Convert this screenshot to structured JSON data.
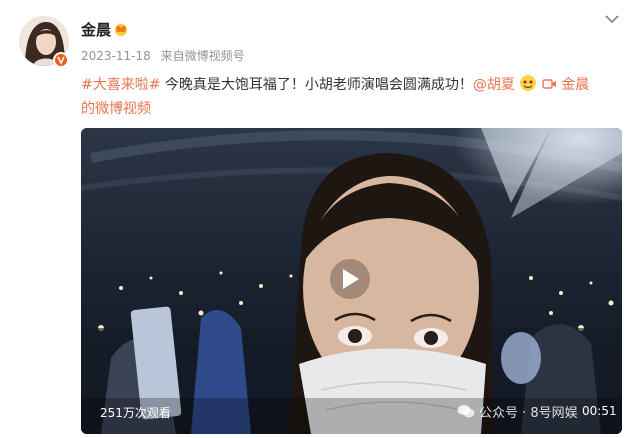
{
  "post": {
    "author": "金晨",
    "date": "2023-11-18",
    "source_prefix": "来自",
    "source": "微博视频号",
    "hashtag": "#大喜来啦#",
    "body_text": " 今晚真是大饱耳福了！小胡老师演唱会圆满成功！",
    "mention": "@胡夏",
    "video_link_name": "金晨",
    "video_link_suffix": "的微博视频"
  },
  "video": {
    "views": "251万次观看",
    "duration": "00:51"
  },
  "watermark": {
    "text": "公众号 · 8号网娱"
  },
  "colors": {
    "link": "#eb7350",
    "meta": "#939393",
    "badge": "#f05a1a"
  },
  "icons": [
    "more-chevron-icon",
    "crown-icon",
    "verified-badge-icon",
    "play-icon",
    "video-link-icon",
    "wechat-icon",
    "emoji-icon"
  ]
}
